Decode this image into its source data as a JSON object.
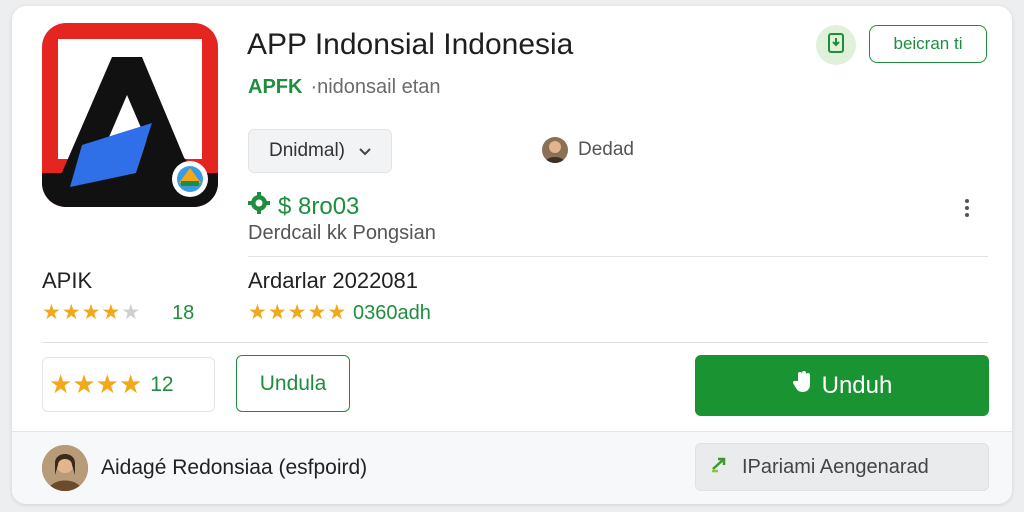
{
  "app": {
    "name": "APP Indonsial Indonesia",
    "brand": "APFK",
    "subtitle_rest": "·nidonsail etan",
    "icon": "app-logo-triangle-icon"
  },
  "header": {
    "wishlist_icon": "bookmark-icon",
    "top_button_label": "beicran ti"
  },
  "details": {
    "dropdown_label": "Dnidmal)",
    "developer_name": "Dedad",
    "price": "$ 8ro03",
    "price_note": "Derdcail kk Pongsian"
  },
  "stats": [
    {
      "label": "APIK",
      "stars": 4,
      "count": "18"
    },
    {
      "label": "Ardarlar 2022081",
      "stars": 5,
      "count": "0360adh"
    }
  ],
  "actions": {
    "rating_stars": 4,
    "rating_value": "12",
    "secondary_label": "Undula",
    "install_label": "Unduh",
    "install_icon": "hand-icon"
  },
  "footer": {
    "user_text": "Aidagé Redonsiaa (esfpoird)",
    "button_label": "IPariami Aengenarad",
    "button_icon": "link-arrow-icon"
  },
  "colors": {
    "accent": "#1a9332",
    "star": "#f2a81d",
    "brand_red": "#e52620",
    "brand_blue": "#2f6fe8"
  }
}
